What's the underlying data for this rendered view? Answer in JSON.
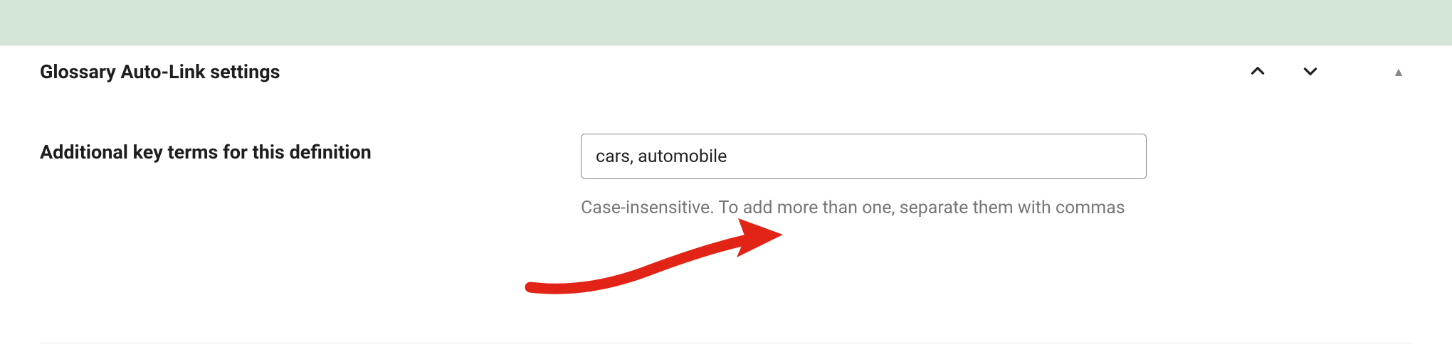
{
  "topBand": {
    "color": "#d3e6d8"
  },
  "panel": {
    "title": "Glossary Auto-Link settings"
  },
  "field": {
    "label": "Additional key terms for this definition",
    "value": "cars, automobile",
    "help": "Case-insensitive. To add more than one, separate them with commas"
  },
  "icons": {
    "moveUp": "chevron-up",
    "moveDown": "chevron-down",
    "collapse": "triangle-up"
  },
  "annotation": {
    "type": "arrow",
    "color": "#e22416"
  }
}
